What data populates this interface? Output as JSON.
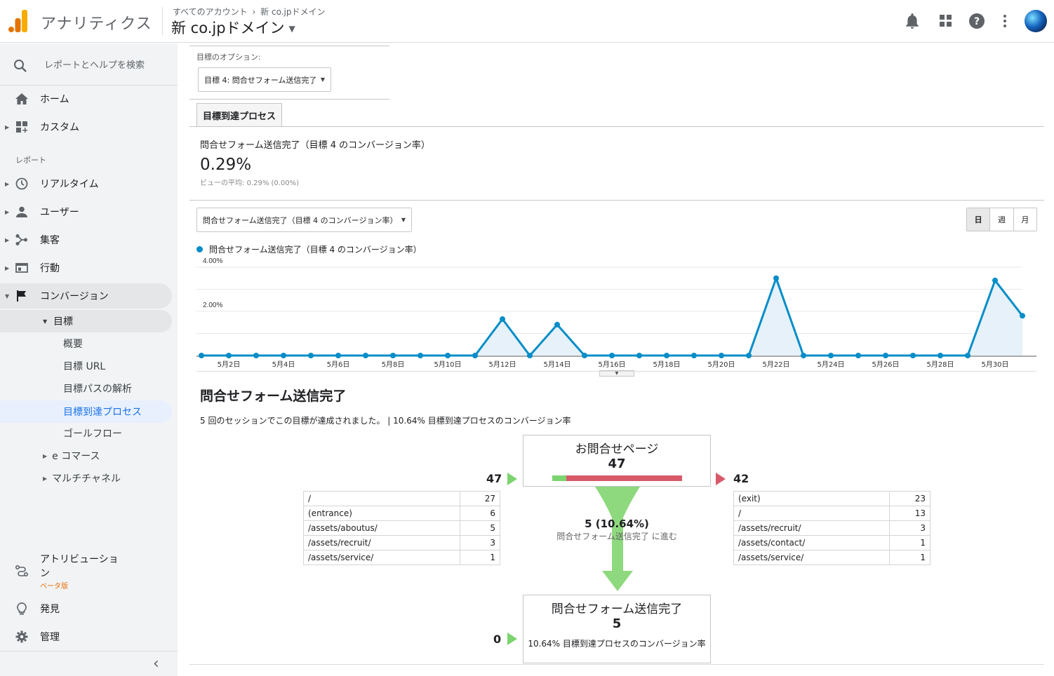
{
  "header": {
    "app_title": "アナリティクス",
    "breadcrumb_all": "すべてのアカウント",
    "breadcrumb_sep": "›",
    "breadcrumb_property": "新 co.jpドメイン",
    "property_name": "新 co.jpドメイン",
    "icons": [
      "bell-icon",
      "apps-icon",
      "help-icon",
      "more-vert-icon",
      "avatar"
    ]
  },
  "sidebar": {
    "search_placeholder": "レポートとヘルプを検索",
    "home": "ホーム",
    "custom": "カスタム",
    "reports_section": "レポート",
    "realtime": "リアルタイム",
    "users": "ユーザー",
    "acquisition": "集客",
    "behavior": "行動",
    "conversions": "コンバージョン",
    "goals": "目標",
    "goal_items": [
      "概要",
      "目標 URL",
      "目標パスの解析",
      "目標到達プロセス",
      "ゴールフロー"
    ],
    "ecommerce": "e コマース",
    "multichannel": "マルチチャネル",
    "attribution": "アトリビューション",
    "attribution_beta": "ベータ版",
    "discover": "発見",
    "admin": "管理",
    "collapse": "‹"
  },
  "main": {
    "goal_option_label": "目標のオプション:",
    "goal_select": "目標 4: 問合せフォーム送信完了",
    "tab_label": "目標到達プロセス",
    "metric_title": "問合せフォーム送信完了（目標 4 のコンバージョン率）",
    "metric_value": "0.29%",
    "metric_avg": "ビューの平均: 0.29% (0.00%)",
    "chart_metric_select": "問合せフォーム送信完了（目標 4 のコンバージョン率）",
    "period_buttons": [
      "日",
      "週",
      "月"
    ],
    "legend_label": "問合せフォーム送信完了（目標 4 のコンバージョン率）",
    "funnel_title": "問合せフォーム送信完了",
    "funnel_summary": "5 回のセッションでこの目標が達成されました。 | 10.64% 目標到達プロセスのコンバージョン率"
  },
  "chart_data": {
    "type": "line",
    "y_ticks": [
      "4.00%",
      "2.00%"
    ],
    "ylim": [
      0,
      4.0
    ],
    "x_labels": [
      "5月2日",
      "5月4日",
      "5月6日",
      "5月8日",
      "5月10日",
      "5月12日",
      "5月14日",
      "5月16日",
      "5月18日",
      "5月20日",
      "5月22日",
      "5月24日",
      "5月26日",
      "5月28日",
      "5月30日"
    ],
    "series": [
      {
        "name": "問合せフォーム送信完了（目標 4 のコンバージョン率）",
        "color": "#058dc7",
        "x": [
          "5月1日",
          "5月2日",
          "5月3日",
          "5月4日",
          "5月5日",
          "5月6日",
          "5月7日",
          "5月8日",
          "5月9日",
          "5月10日",
          "5月11日",
          "5月12日",
          "5月13日",
          "5月14日",
          "5月15日",
          "5月16日",
          "5月17日",
          "5月18日",
          "5月19日",
          "5月20日",
          "5月21日",
          "5月22日",
          "5月23日",
          "5月24日",
          "5月25日",
          "5月26日",
          "5月27日",
          "5月28日",
          "5月29日",
          "5月30日",
          "5月31日"
        ],
        "values": [
          0,
          0,
          0,
          0,
          0,
          0,
          0,
          0,
          0,
          0,
          0,
          1.65,
          0,
          1.4,
          0,
          0,
          0,
          0,
          0,
          0,
          0,
          3.5,
          0,
          0,
          0,
          0,
          0,
          0,
          0,
          3.4,
          1.8
        ]
      }
    ],
    "grid": true
  },
  "funnel": {
    "stage1": {
      "name": "お問合せページ",
      "count": "47",
      "entries": "47",
      "exits": "42",
      "progress": 0.106,
      "colors": {
        "continue": "#7cd36f",
        "exit": "#d85a6a"
      },
      "entry_sources": [
        [
          "/",
          "27"
        ],
        [
          "(entrance)",
          "6"
        ],
        [
          "/assets/aboutus/",
          "5"
        ],
        [
          "/assets/recruit/",
          "3"
        ],
        [
          "/assets/service/",
          "1"
        ]
      ],
      "exit_destinations": [
        [
          "(exit)",
          "23"
        ],
        [
          "/",
          "13"
        ],
        [
          "/assets/recruit/",
          "3"
        ],
        [
          "/assets/contact/",
          "1"
        ],
        [
          "/assets/service/",
          "1"
        ]
      ]
    },
    "flow_label_value": "5 (10.64%)",
    "flow_label_text": "問合せフォーム送信完了 に進む",
    "stage2": {
      "name": "問合せフォーム送信完了",
      "count": "5",
      "entries": "0",
      "conversion_text": "10.64% 目標到達プロセスのコンバージョン率"
    }
  }
}
